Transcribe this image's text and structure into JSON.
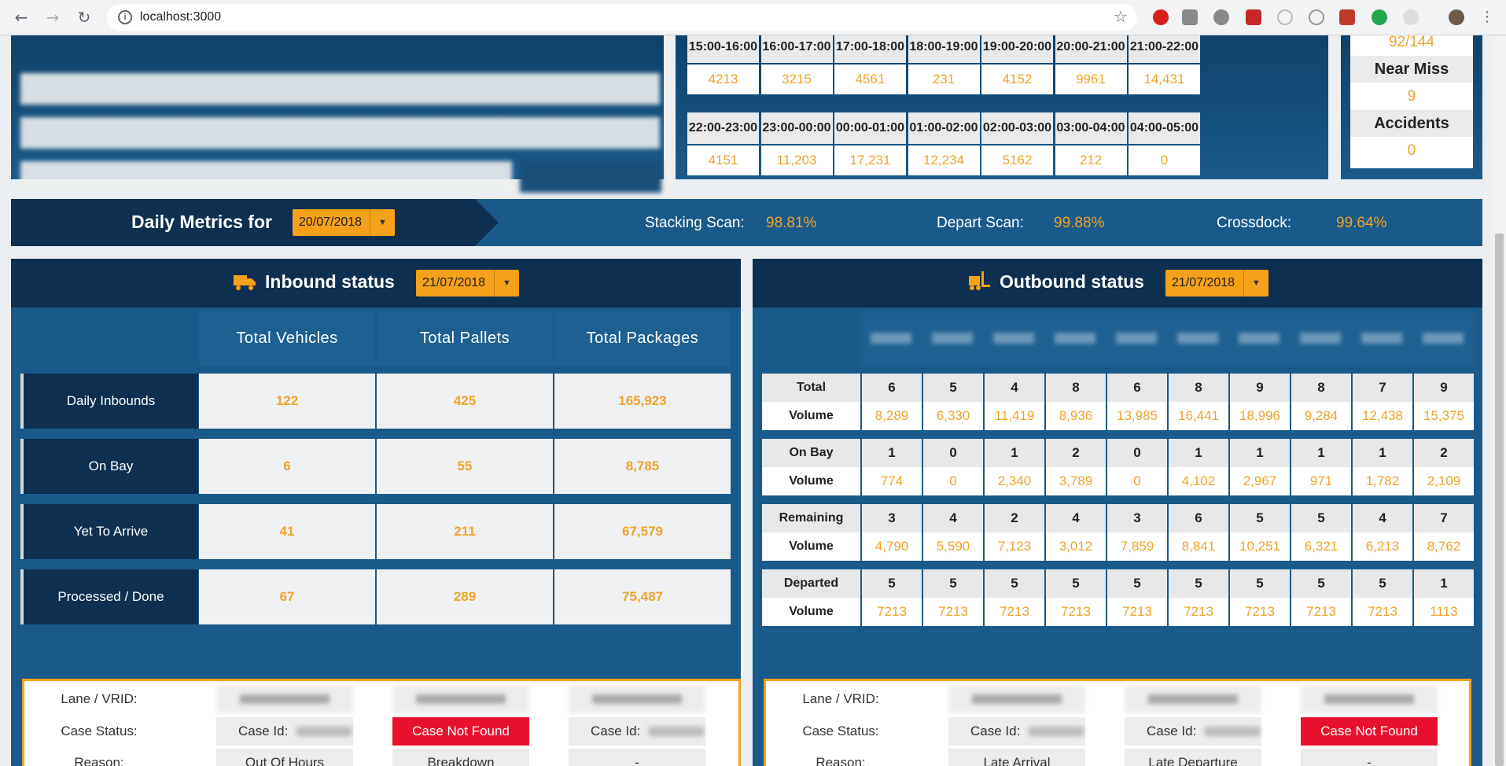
{
  "browser": {
    "url": "localhost:3000"
  },
  "colors": {
    "accent": "#f6a11a",
    "navy": "#0e2f4f",
    "panel": "#1a5a8a",
    "red": "#e8112d"
  },
  "hourly": {
    "row1": {
      "times": [
        "15:00-16:00",
        "16:00-17:00",
        "17:00-18:00",
        "18:00-19:00",
        "19:00-20:00",
        "20:00-21:00",
        "21:00-22:00"
      ],
      "values": [
        "4213",
        "3215",
        "4561",
        "231",
        "4152",
        "9961",
        "14,431"
      ]
    },
    "row2": {
      "times": [
        "22:00-23:00",
        "23:00-00:00",
        "00:00-01:00",
        "01:00-02:00",
        "02:00-03:00",
        "03:00-04:00",
        "04:00-05:00"
      ],
      "values": [
        "4151",
        "11,203",
        "17,231",
        "12,234",
        "5162",
        "212",
        "0"
      ]
    }
  },
  "safety": {
    "top_value": "92/144",
    "near_miss_label": "Near Miss",
    "near_miss_value": "9",
    "accidents_label": "Accidents",
    "accidents_value": "0"
  },
  "metrics": {
    "title": "Daily Metrics for",
    "date": "20/07/2018",
    "stacking_label": "Stacking Scan:",
    "stacking_value": "98.81%",
    "depart_label": "Depart Scan:",
    "depart_value": "99.88%",
    "crossdock_label": "Crossdock:",
    "crossdock_value": "99.64%"
  },
  "inbound": {
    "title": "Inbound status",
    "date": "21/07/2018",
    "columns": [
      "Total Vehicles",
      "Total Pallets",
      "Total Packages"
    ],
    "rows": [
      {
        "label": "Daily Inbounds",
        "values": [
          "122",
          "425",
          "165,923"
        ]
      },
      {
        "label": "On Bay",
        "values": [
          "6",
          "55",
          "8,785"
        ]
      },
      {
        "label": "Yet To Arrive",
        "values": [
          "41",
          "211",
          "67,579"
        ]
      },
      {
        "label": "Processed / Done",
        "values": [
          "67",
          "289",
          "75,487"
        ]
      }
    ],
    "case": {
      "lane_label": "Lane / VRID:",
      "status_label": "Case Status:",
      "reason_label": "Reason:",
      "case_id_label": "Case Id:",
      "not_found": "Case Not Found",
      "reasons": [
        "Out Of Hours",
        "Breakdown",
        "-"
      ]
    }
  },
  "outbound": {
    "title": "Outbound status",
    "date": "21/07/2018",
    "groups": [
      {
        "label": "Total",
        "values": [
          "6",
          "5",
          "4",
          "8",
          "6",
          "8",
          "9",
          "8",
          "7",
          "9"
        ],
        "volume_label": "Volume",
        "volumes": [
          "8,289",
          "6,330",
          "11,419",
          "8,936",
          "13,985",
          "16,441",
          "18,996",
          "9,284",
          "12,438",
          "15,375"
        ]
      },
      {
        "label": "On Bay",
        "values": [
          "1",
          "0",
          "1",
          "2",
          "0",
          "1",
          "1",
          "1",
          "1",
          "2"
        ],
        "volume_label": "Volume",
        "volumes": [
          "774",
          "0",
          "2,340",
          "3,789",
          "0",
          "4,102",
          "2,967",
          "971",
          "1,782",
          "2,109"
        ]
      },
      {
        "label": "Remaining",
        "values": [
          "3",
          "4",
          "2",
          "4",
          "3",
          "6",
          "5",
          "5",
          "4",
          "7"
        ],
        "volume_label": "Volume",
        "volumes": [
          "4,790",
          "5,590",
          "7,123",
          "3,012",
          "7,859",
          "8,841",
          "10,251",
          "6,321",
          "6,213",
          "8,762"
        ]
      },
      {
        "label": "Departed",
        "values": [
          "5",
          "5",
          "5",
          "5",
          "5",
          "5",
          "5",
          "5",
          "5",
          "1"
        ],
        "volume_label": "Volume",
        "volumes": [
          "7213",
          "7213",
          "7213",
          "7213",
          "7213",
          "7213",
          "7213",
          "7213",
          "7213",
          "1113"
        ]
      }
    ],
    "case": {
      "lane_label": "Lane / VRID:",
      "status_label": "Case Status:",
      "reason_label": "Reason:",
      "case_id_label": "Case Id:",
      "not_found": "Case Not Found",
      "reasons": [
        "Late Arrival",
        "Late Departure",
        "-"
      ]
    }
  }
}
